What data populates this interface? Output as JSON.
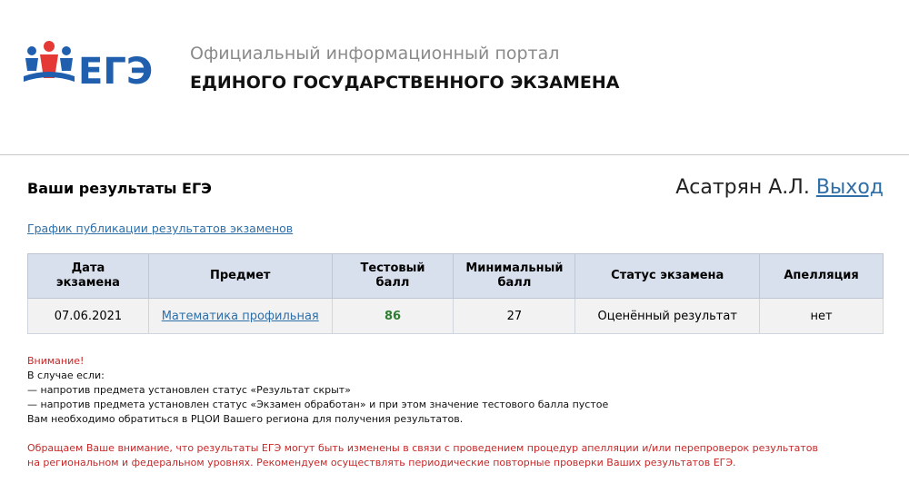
{
  "header": {
    "logo_text": "ЕГЭ",
    "portal_subtitle": "Официальный информационный портал",
    "portal_title": "ЕДИНОГО ГОСУДАРСТВЕННОГО ЭКЗАМЕНА"
  },
  "page": {
    "title": "Ваши результаты ЕГЭ",
    "user_name": "Асатрян А.Л.",
    "logout_label": "Выход",
    "schedule_link": "График публикации результатов экзаменов"
  },
  "table": {
    "headers": {
      "date_line1": "Дата",
      "date_line2": "экзамена",
      "subject": "Предмет",
      "test_score_line1": "Тестовый",
      "test_score_line2": "балл",
      "min_score_line1": "Минимальный",
      "min_score_line2": "балл",
      "status": "Статус экзамена",
      "appeal": "Апелляция"
    },
    "rows": [
      {
        "date": "07.06.2021",
        "subject": "Математика профильная",
        "test_score": "86",
        "min_score": "27",
        "status": "Оценённый результат",
        "appeal": "нет"
      }
    ]
  },
  "notice": {
    "heading": "Внимание!",
    "line1": "В случае если:",
    "line2": "— напротив предмета установлен статус «Результат скрыт»",
    "line3": "— напротив предмета установлен статус «Экзамен обработан» и при этом значение тестового балла пустое",
    "line4": "Вам необходимо обратиться в РЦОИ Вашего региона для получения результатов."
  },
  "warning": {
    "line1": "Обращаем Ваше внимание, что результаты ЕГЭ могут быть изменены в связи с проведением процедур апелляции и/или перепроверок результатов",
    "line2": "на региональном и федеральном уровнях. Рекомендуем осуществлять периодические повторные проверки Ваших результатов ЕГЭ."
  },
  "colors": {
    "link": "#2f6fa8",
    "logo_blue": "#1f5fae",
    "logo_red": "#e53935",
    "table_header": "#d8e0ee",
    "score_green": "#2e7d32",
    "warning_red": "#c62828"
  }
}
